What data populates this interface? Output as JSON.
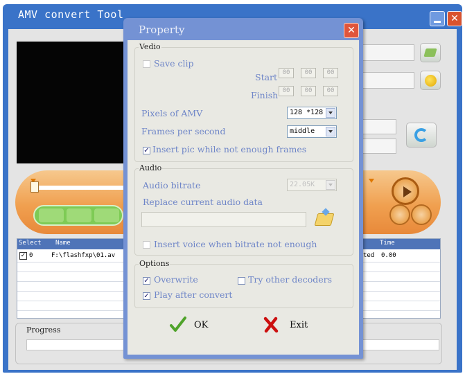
{
  "main_window": {
    "title": "AMV convert Tool",
    "list_headers": [
      "Select",
      "Name",
      "Time"
    ],
    "row": {
      "checked": true,
      "index": "0",
      "name": "F:\\flashfxp\\01.av",
      "status_fragment": "ted",
      "time": "0.00"
    },
    "progress_label": "Progress",
    "progress_fraction": 0
  },
  "dialog": {
    "title": "Property",
    "video": {
      "group_label": "Vedio",
      "save_clip_label": "Save clip",
      "save_clip_checked": false,
      "start_label": "Start",
      "finish_label": "Finish",
      "start_values": [
        "00",
        "00",
        "00"
      ],
      "finish_values": [
        "00",
        "00",
        "00"
      ],
      "pixels_label": "Pixels of AMV",
      "pixels_value": "128 *128",
      "fps_label": "Frames per second",
      "fps_value": "middle",
      "insert_pic_label": "Insert pic while not enough frames",
      "insert_pic_checked": true
    },
    "audio": {
      "group_label": "Audio",
      "bitrate_label": "Audio bitrate",
      "bitrate_value": "22.05K",
      "replace_label": "Replace current audio data",
      "insert_voice_label": "Insert voice when bitrate not enough",
      "insert_voice_checked": false
    },
    "options": {
      "group_label": "Options",
      "overwrite_label": "Overwrite",
      "overwrite_checked": true,
      "try_decoders_label": "Try other decoders",
      "try_decoders_checked": false,
      "play_after_label": "Play after convert",
      "play_after_checked": true
    },
    "buttons": {
      "ok_label": "OK",
      "exit_label": "Exit"
    }
  },
  "icons": {
    "ok": "checkmark-icon",
    "exit": "x-icon",
    "browse": "folder-open-icon",
    "convert": "refresh-icon",
    "play": "play-icon"
  },
  "colors": {
    "title_bar": "#3a73c8",
    "player_bar": "#f0a050",
    "label_text": "#6f86c8",
    "ok_check": "#4fa32a",
    "exit_x": "#cc1010"
  }
}
